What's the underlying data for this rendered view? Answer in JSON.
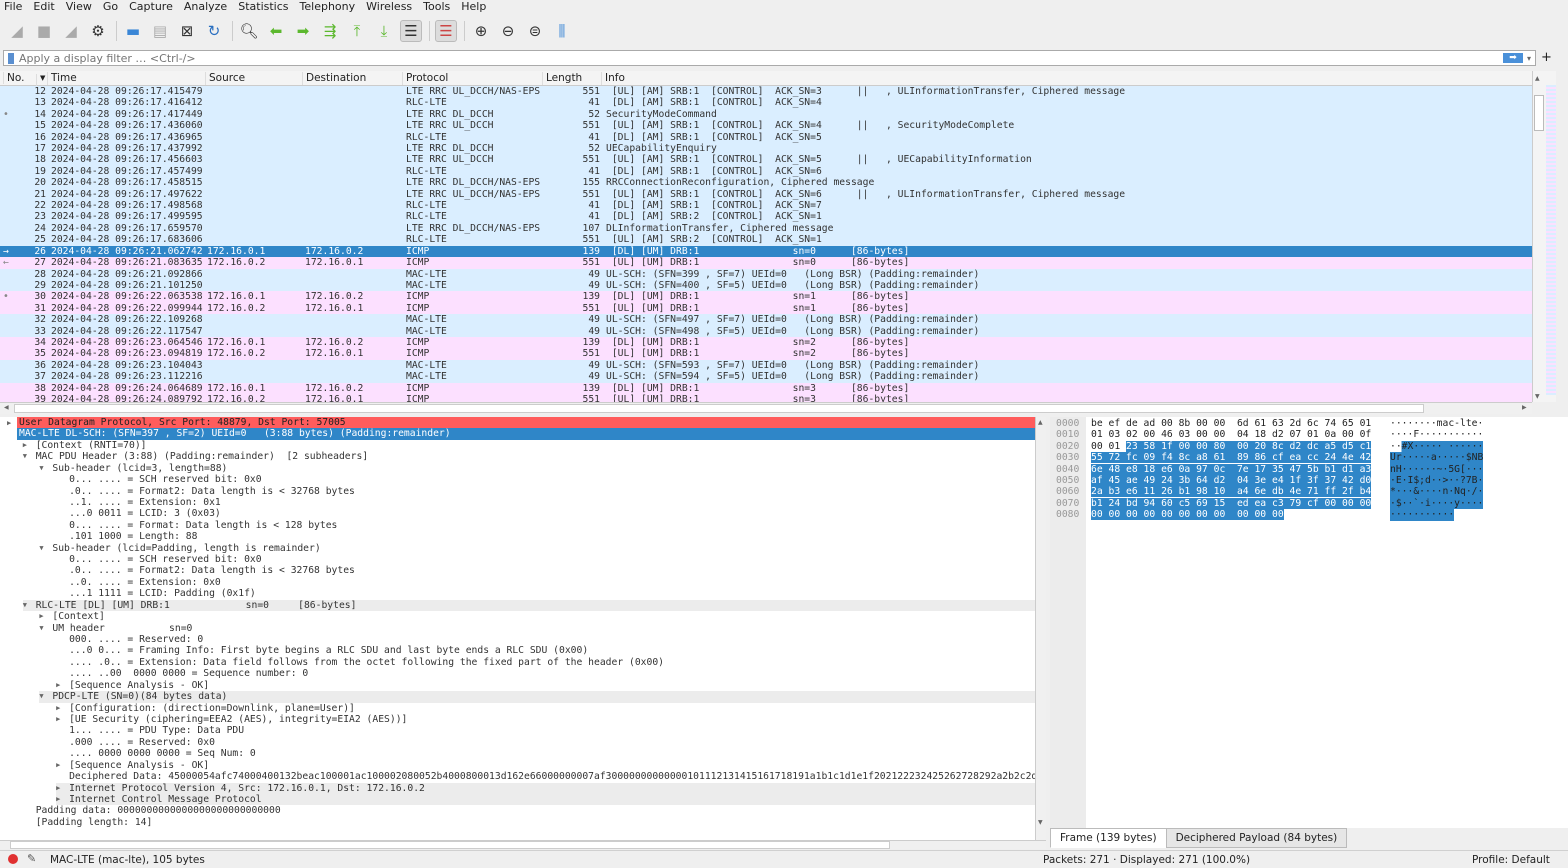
{
  "menu": [
    "File",
    "Edit",
    "View",
    "Go",
    "Capture",
    "Analyze",
    "Statistics",
    "Telephony",
    "Wireless",
    "Tools",
    "Help"
  ],
  "toolbar": [
    {
      "icon": "shark-fin-start-icon",
      "g": "◢",
      "state": "disabled"
    },
    {
      "icon": "stop-icon",
      "g": "■",
      "state": "disabled"
    },
    {
      "icon": "restart-icon",
      "g": "◢",
      "state": "disabled"
    },
    {
      "icon": "capture-options-gear-icon",
      "g": "⚙",
      "state": "normal"
    },
    {
      "sep": true
    },
    {
      "icon": "open-folder-icon",
      "g": "▬",
      "state": "normal",
      "color": "#3a86d6"
    },
    {
      "icon": "save-file-icon",
      "g": "▤",
      "state": "disabled"
    },
    {
      "icon": "close-file-icon",
      "g": "⊠",
      "state": "normal"
    },
    {
      "icon": "reload-icon",
      "g": "↻",
      "state": "normal",
      "color": "#2a6fc0"
    },
    {
      "sep": true
    },
    {
      "icon": "find-packet-icon",
      "g": "🔍︎",
      "state": "normal"
    },
    {
      "icon": "go-back-icon",
      "g": "⬅",
      "state": "normal",
      "color": "#5cb82e"
    },
    {
      "icon": "go-forward-icon",
      "g": "➡",
      "state": "normal",
      "color": "#5cb82e"
    },
    {
      "icon": "go-to-packet-icon",
      "g": "⇶",
      "state": "normal",
      "color": "#5cb82e"
    },
    {
      "icon": "first-packet-icon",
      "g": "⤒",
      "state": "normal",
      "color": "#5cb82e"
    },
    {
      "icon": "last-packet-icon",
      "g": "⤓",
      "state": "normal",
      "color": "#5cb82e"
    },
    {
      "icon": "auto-scroll-icon",
      "g": "☰",
      "state": "on"
    },
    {
      "sep": true
    },
    {
      "icon": "colorize-icon",
      "g": "☰",
      "state": "on",
      "color": "#c44"
    },
    {
      "sep": true
    },
    {
      "icon": "zoom-in-icon",
      "g": "⊕",
      "state": "normal"
    },
    {
      "icon": "zoom-out-icon",
      "g": "⊖",
      "state": "normal"
    },
    {
      "icon": "zoom-normal-icon",
      "g": "⊜",
      "state": "normal"
    },
    {
      "icon": "resize-columns-icon",
      "g": "⫼",
      "state": "normal",
      "color": "#3a86d6"
    }
  ],
  "filter": {
    "placeholder": "Apply a display filter … <Ctrl-/>",
    "value": ""
  },
  "colors": {
    "blue_row": "#daeeff",
    "pink_row": "#fce0ff",
    "selected": "#2f86c8",
    "error_row": "#ff5c5c"
  },
  "columns": [
    "No.",
    "Time",
    "Source",
    "Destination",
    "Protocol",
    "Length",
    "Info"
  ],
  "packets": [
    {
      "no": "12",
      "time": "2024-04-28 09:26:17.415479",
      "src": "",
      "dst": "",
      "proto": "LTE RRC UL_DCCH/NAS-EPS",
      "len": "551",
      "info": " [UL] [AM] SRB:1  [CONTROL]  ACK_SN=3      ||   , ULInformationTransfer, Ciphered message",
      "c": "blue"
    },
    {
      "no": "13",
      "time": "2024-04-28 09:26:17.416412",
      "src": "",
      "dst": "",
      "proto": "RLC-LTE",
      "len": "41",
      "info": " [DL] [AM] SRB:1  [CONTROL]  ACK_SN=4",
      "c": "blue"
    },
    {
      "no": "14",
      "time": "2024-04-28 09:26:17.417449",
      "src": "",
      "dst": "",
      "proto": "LTE RRC DL_DCCH",
      "len": "52",
      "info": "SecurityModeCommand",
      "c": "blue",
      "mark": "•"
    },
    {
      "no": "15",
      "time": "2024-04-28 09:26:17.436060",
      "src": "",
      "dst": "",
      "proto": "LTE RRC UL_DCCH",
      "len": "551",
      "info": " [UL] [AM] SRB:1  [CONTROL]  ACK_SN=4      ||   , SecurityModeComplete",
      "c": "blue"
    },
    {
      "no": "16",
      "time": "2024-04-28 09:26:17.436965",
      "src": "",
      "dst": "",
      "proto": "RLC-LTE",
      "len": "41",
      "info": " [DL] [AM] SRB:1  [CONTROL]  ACK_SN=5",
      "c": "blue"
    },
    {
      "no": "17",
      "time": "2024-04-28 09:26:17.437992",
      "src": "",
      "dst": "",
      "proto": "LTE RRC DL_DCCH",
      "len": "52",
      "info": "UECapabilityEnquiry",
      "c": "blue"
    },
    {
      "no": "18",
      "time": "2024-04-28 09:26:17.456603",
      "src": "",
      "dst": "",
      "proto": "LTE RRC UL_DCCH",
      "len": "551",
      "info": " [UL] [AM] SRB:1  [CONTROL]  ACK_SN=5      ||   , UECapabilityInformation",
      "c": "blue"
    },
    {
      "no": "19",
      "time": "2024-04-28 09:26:17.457499",
      "src": "",
      "dst": "",
      "proto": "RLC-LTE",
      "len": "41",
      "info": " [DL] [AM] SRB:1  [CONTROL]  ACK_SN=6",
      "c": "blue"
    },
    {
      "no": "20",
      "time": "2024-04-28 09:26:17.458515",
      "src": "",
      "dst": "",
      "proto": "LTE RRC DL_DCCH/NAS-EPS",
      "len": "155",
      "info": "RRCConnectionReconfiguration, Ciphered message",
      "c": "blue"
    },
    {
      "no": "21",
      "time": "2024-04-28 09:26:17.497622",
      "src": "",
      "dst": "",
      "proto": "LTE RRC UL_DCCH/NAS-EPS",
      "len": "551",
      "info": " [UL] [AM] SRB:1  [CONTROL]  ACK_SN=6      ||   , ULInformationTransfer, Ciphered message",
      "c": "blue"
    },
    {
      "no": "22",
      "time": "2024-04-28 09:26:17.498568",
      "src": "",
      "dst": "",
      "proto": "RLC-LTE",
      "len": "41",
      "info": " [DL] [AM] SRB:1  [CONTROL]  ACK_SN=7",
      "c": "blue"
    },
    {
      "no": "23",
      "time": "2024-04-28 09:26:17.499595",
      "src": "",
      "dst": "",
      "proto": "RLC-LTE",
      "len": "41",
      "info": " [DL] [AM] SRB:2  [CONTROL]  ACK_SN=1",
      "c": "blue"
    },
    {
      "no": "24",
      "time": "2024-04-28 09:26:17.659570",
      "src": "",
      "dst": "",
      "proto": "LTE RRC DL_DCCH/NAS-EPS",
      "len": "107",
      "info": "DLInformationTransfer, Ciphered message",
      "c": "blue"
    },
    {
      "no": "25",
      "time": "2024-04-28 09:26:17.683606",
      "src": "",
      "dst": "",
      "proto": "RLC-LTE",
      "len": "551",
      "info": " [UL] [AM] SRB:2  [CONTROL]  ACK_SN=1",
      "c": "blue"
    },
    {
      "no": "26",
      "time": "2024-04-28 09:26:21.062742",
      "src": "172.16.0.1",
      "dst": "172.16.0.2",
      "proto": "ICMP",
      "len": "139",
      "info": " [DL] [UM] DRB:1                sn=0      [86-bytes]",
      "c": "sel",
      "mark": "→"
    },
    {
      "no": "27",
      "time": "2024-04-28 09:26:21.083635",
      "src": "172.16.0.2",
      "dst": "172.16.0.1",
      "proto": "ICMP",
      "len": "551",
      "info": " [UL] [UM] DRB:1                sn=0      [86-bytes]",
      "c": "pink",
      "mark": "←"
    },
    {
      "no": "28",
      "time": "2024-04-28 09:26:21.092866",
      "src": "",
      "dst": "",
      "proto": "MAC-LTE",
      "len": "49",
      "info": "UL-SCH: (SFN=399 , SF=7) UEId=0   (Long BSR) (Padding:remainder)",
      "c": "blue"
    },
    {
      "no": "29",
      "time": "2024-04-28 09:26:21.101250",
      "src": "",
      "dst": "",
      "proto": "MAC-LTE",
      "len": "49",
      "info": "UL-SCH: (SFN=400 , SF=5) UEId=0   (Long BSR) (Padding:remainder)",
      "c": "blue"
    },
    {
      "no": "30",
      "time": "2024-04-28 09:26:22.063538",
      "src": "172.16.0.1",
      "dst": "172.16.0.2",
      "proto": "ICMP",
      "len": "139",
      "info": " [DL] [UM] DRB:1                sn=1      [86-bytes]",
      "c": "pink",
      "mark": "•"
    },
    {
      "no": "31",
      "time": "2024-04-28 09:26:22.099944",
      "src": "172.16.0.2",
      "dst": "172.16.0.1",
      "proto": "ICMP",
      "len": "551",
      "info": " [UL] [UM] DRB:1                sn=1      [86-bytes]",
      "c": "pink"
    },
    {
      "no": "32",
      "time": "2024-04-28 09:26:22.109268",
      "src": "",
      "dst": "",
      "proto": "MAC-LTE",
      "len": "49",
      "info": "UL-SCH: (SFN=497 , SF=7) UEId=0   (Long BSR) (Padding:remainder)",
      "c": "blue"
    },
    {
      "no": "33",
      "time": "2024-04-28 09:26:22.117547",
      "src": "",
      "dst": "",
      "proto": "MAC-LTE",
      "len": "49",
      "info": "UL-SCH: (SFN=498 , SF=5) UEId=0   (Long BSR) (Padding:remainder)",
      "c": "blue"
    },
    {
      "no": "34",
      "time": "2024-04-28 09:26:23.064546",
      "src": "172.16.0.1",
      "dst": "172.16.0.2",
      "proto": "ICMP",
      "len": "139",
      "info": " [DL] [UM] DRB:1                sn=2      [86-bytes]",
      "c": "pink"
    },
    {
      "no": "35",
      "time": "2024-04-28 09:26:23.094819",
      "src": "172.16.0.2",
      "dst": "172.16.0.1",
      "proto": "ICMP",
      "len": "551",
      "info": " [UL] [UM] DRB:1                sn=2      [86-bytes]",
      "c": "pink"
    },
    {
      "no": "36",
      "time": "2024-04-28 09:26:23.104043",
      "src": "",
      "dst": "",
      "proto": "MAC-LTE",
      "len": "49",
      "info": "UL-SCH: (SFN=593 , SF=7) UEId=0   (Long BSR) (Padding:remainder)",
      "c": "blue"
    },
    {
      "no": "37",
      "time": "2024-04-28 09:26:23.112216",
      "src": "",
      "dst": "",
      "proto": "MAC-LTE",
      "len": "49",
      "info": "UL-SCH: (SFN=594 , SF=5) UEId=0   (Long BSR) (Padding:remainder)",
      "c": "blue"
    },
    {
      "no": "38",
      "time": "2024-04-28 09:26:24.064689",
      "src": "172.16.0.1",
      "dst": "172.16.0.2",
      "proto": "ICMP",
      "len": "139",
      "info": " [DL] [UM] DRB:1                sn=3      [86-bytes]",
      "c": "pink"
    },
    {
      "no": "39",
      "time": "2024-04-28 09:26:24.089792",
      "src": "172.16.0.2",
      "dst": "172.16.0.1",
      "proto": "ICMP",
      "len": "551",
      "info": " [UL] [UM] DRB:1                sn=3      [86-bytes]",
      "c": "pink"
    }
  ],
  "details": [
    {
      "d": 0,
      "a": "closed",
      "t": "User Datagram Protocol, Src Port: 48879, Dst Port: 57005",
      "s": "red"
    },
    {
      "d": 0,
      "a": "open",
      "t": "MAC-LTE DL-SCH: (SFN=397 , SF=2) UEId=0   (3:88 bytes) (Padding:remainder)",
      "s": "sel"
    },
    {
      "d": 1,
      "a": "closed",
      "t": "[Context (RNTI=70)]"
    },
    {
      "d": 1,
      "a": "open",
      "t": "MAC PDU Header (3:88) (Padding:remainder)  [2 subheaders]"
    },
    {
      "d": 2,
      "a": "open",
      "t": "Sub-header (lcid=3, length=88)"
    },
    {
      "d": 3,
      "t": "0... .... = SCH reserved bit: 0x0"
    },
    {
      "d": 3,
      "t": ".0.. .... = Format2: Data length is < 32768 bytes"
    },
    {
      "d": 3,
      "t": "..1. .... = Extension: 0x1"
    },
    {
      "d": 3,
      "t": "...0 0011 = LCID: 3 (0x03)"
    },
    {
      "d": 3,
      "t": "0... .... = Format: Data length is < 128 bytes"
    },
    {
      "d": 3,
      "t": ".101 1000 = Length: 88"
    },
    {
      "d": 2,
      "a": "open",
      "t": "Sub-header (lcid=Padding, length is remainder)"
    },
    {
      "d": 3,
      "t": "0... .... = SCH reserved bit: 0x0"
    },
    {
      "d": 3,
      "t": ".0.. .... = Format2: Data length is < 32768 bytes"
    },
    {
      "d": 3,
      "t": "..0. .... = Extension: 0x0"
    },
    {
      "d": 3,
      "t": "...1 1111 = LCID: Padding (0x1f)"
    },
    {
      "d": 1,
      "a": "open",
      "t": "RLC-LTE [DL] [UM] DRB:1             sn=0     [86-bytes]",
      "s": "shade"
    },
    {
      "d": 2,
      "a": "closed",
      "t": "[Context]"
    },
    {
      "d": 2,
      "a": "open",
      "t": "UM header           sn=0"
    },
    {
      "d": 3,
      "t": "000. .... = Reserved: 0"
    },
    {
      "d": 3,
      "t": "...0 0... = Framing Info: First byte begins a RLC SDU and last byte ends a RLC SDU (0x00)"
    },
    {
      "d": 3,
      "t": ".... .0.. = Extension: Data field follows from the octet following the fixed part of the header (0x00)"
    },
    {
      "d": 3,
      "t": ".... ..00  0000 0000 = Sequence number: 0"
    },
    {
      "d": 3,
      "a": "closed",
      "t": "[Sequence Analysis - OK]"
    },
    {
      "d": 2,
      "a": "open",
      "t": "PDCP-LTE (SN=0)(84 bytes data)",
      "s": "shade"
    },
    {
      "d": 3,
      "a": "closed",
      "t": "[Configuration: (direction=Downlink, plane=User)]"
    },
    {
      "d": 3,
      "a": "closed",
      "t": "[UE Security (ciphering=EEA2 (AES), integrity=EIA2 (AES))]"
    },
    {
      "d": 3,
      "t": "1... .... = PDU Type: Data PDU"
    },
    {
      "d": 3,
      "t": ".000 .... = Reserved: 0x0"
    },
    {
      "d": 3,
      "t": ".... 0000 0000 0000 = Seq Num: 0"
    },
    {
      "d": 3,
      "a": "closed",
      "t": "[Sequence Analysis - OK]"
    },
    {
      "d": 3,
      "t": "Deciphered Data: 45000054afc74000400132beac100001ac100002080052b4000800013d162e66000000007af30000000000000101112131415161718191a1b1c1d1e1f202122232425262728292a2b2c2d"
    },
    {
      "d": 3,
      "a": "closed",
      "t": "Internet Protocol Version 4, Src: 172.16.0.1, Dst: 172.16.0.2",
      "s": "shade"
    },
    {
      "d": 3,
      "a": "closed",
      "t": "Internet Control Message Protocol",
      "s": "shade"
    },
    {
      "d": 1,
      "t": "Padding data: 0000000000000000000000000000"
    },
    {
      "d": 1,
      "t": "[Padding length: 14]"
    }
  ],
  "hex": {
    "selected_from_byte": 34,
    "rows": [
      {
        "off": "0000",
        "bytes": "be ef de ad 00 8b 00 00 6d 61 63 2d 6c 74 65 01",
        "ascii": "········mac-lte·"
      },
      {
        "off": "0010",
        "bytes": "01 03 02 00 46 03 00 00 04 18 d2 07 01 0a 00 0f",
        "ascii": "····F···········"
      },
      {
        "off": "0020",
        "bytes": "00 01 23 58 1f 00 00 80 00 20 8c d2 dc a5 d5 c1",
        "ascii": "··#X····· ······"
      },
      {
        "off": "0030",
        "bytes": "55 72 fc 09 f4 8c a8 61 89 86 cf ea cc 24 4e 42",
        "ascii": "Ur·····a·····$NB"
      },
      {
        "off": "0040",
        "bytes": "6e 48 e8 18 e6 0a 97 0c 7e 17 35 47 5b b1 d1 a3",
        "ascii": "nH······~·5G[···"
      },
      {
        "off": "0050",
        "bytes": "af 45 ae 49 24 3b 64 d2 04 3e e4 1f 3f 37 42 d0",
        "ascii": "·E·I$;d··>··?7B·"
      },
      {
        "off": "0060",
        "bytes": "2a b3 e6 11 26 b1 98 10 a4 6e db 4e 71 ff 2f b4",
        "ascii": "*···&····n·Nq·/·"
      },
      {
        "off": "0070",
        "bytes": "b1 24 bd 94 60 c5 69 15 ed ea c3 79 cf 00 00 00",
        "ascii": "·$··`·i····y····"
      },
      {
        "off": "0080",
        "bytes": "00 00 00 00 00 00 00 00 00 00 00",
        "ascii": "···········"
      }
    ]
  },
  "bytes_tabs": [
    {
      "label": "Frame (139 bytes)",
      "active": true
    },
    {
      "label": "Deciphered Payload (84 bytes)",
      "active": false
    }
  ],
  "status": {
    "protocol": "MAC-LTE (mac-lte), 105 bytes",
    "packets": "Packets: 271 · Displayed: 271 (100.0%)",
    "profile": "Profile: Default"
  }
}
